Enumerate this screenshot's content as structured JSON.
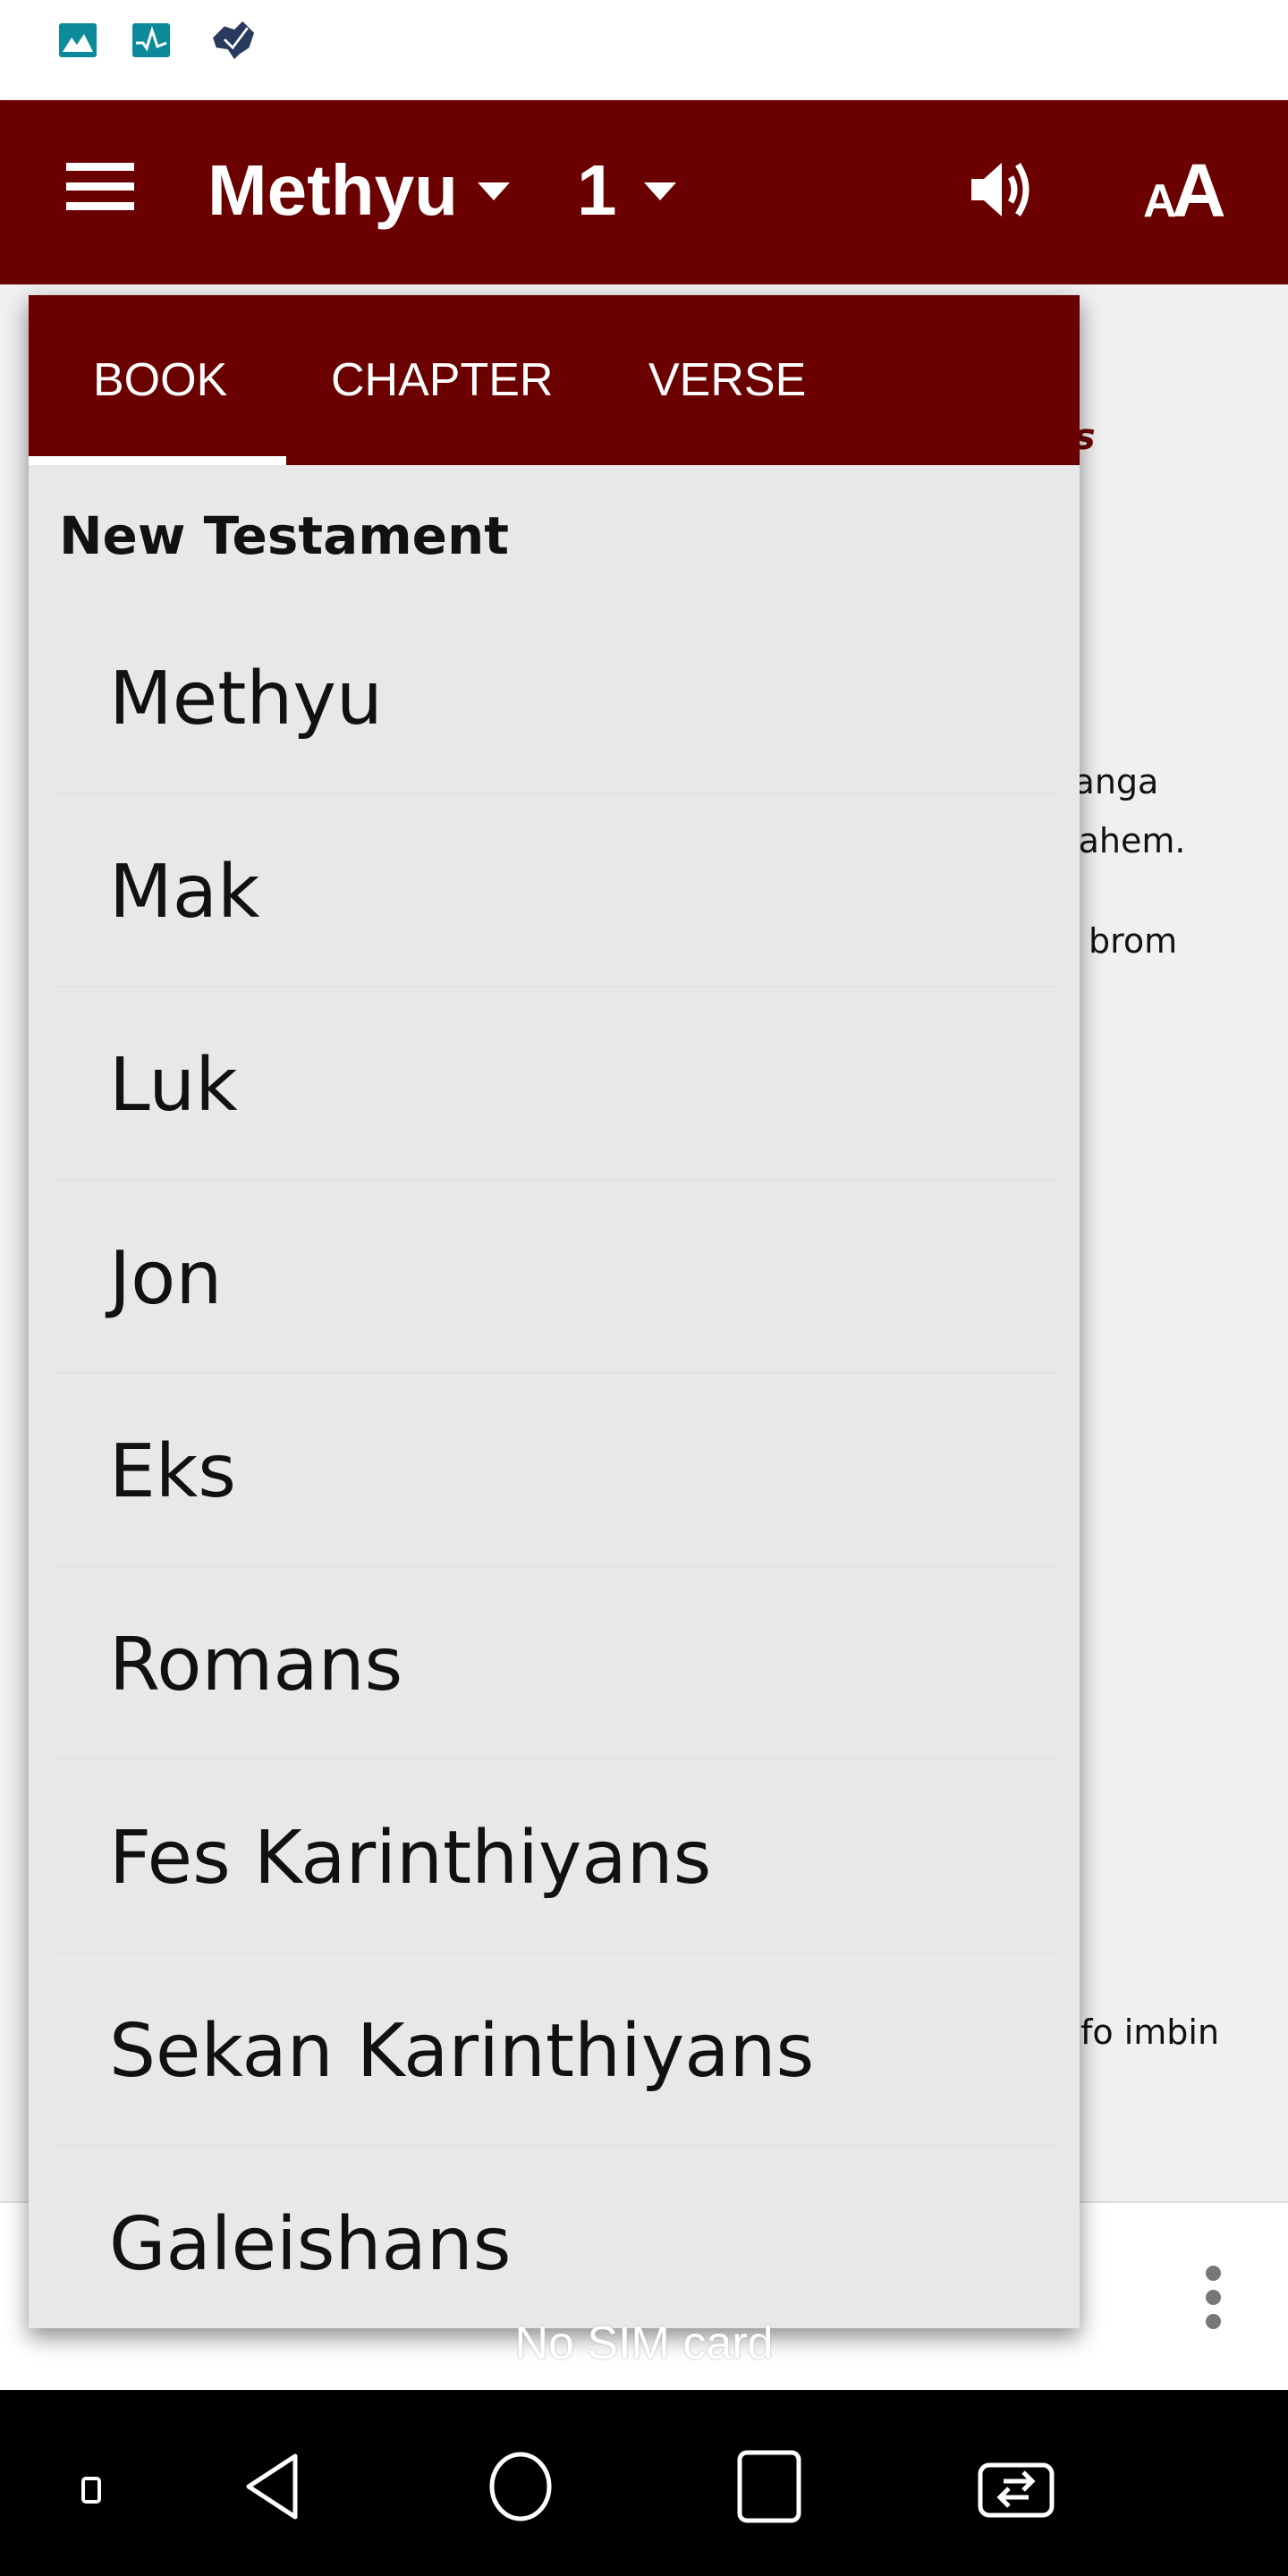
{
  "status_bar": {
    "icons": [
      "gallery-icon",
      "activity-icon",
      "australia-check-icon"
    ]
  },
  "app_bar": {
    "book": "Methyu",
    "chapter": "1",
    "icons": [
      "menu-icon",
      "speaker-icon",
      "text-size-icon"
    ]
  },
  "background_text": {
    "heading_fragment": "sas",
    "lines": [
      "langa",
      "rahem.",
      "t brom",
      "fo imbin"
    ]
  },
  "selector": {
    "tabs": [
      {
        "label": "BOOK",
        "active": true
      },
      {
        "label": "CHAPTER"
      },
      {
        "label": "VERSE"
      }
    ],
    "section": "New Testament",
    "books": [
      "Methyu",
      "Mak",
      "Luk",
      "Jon",
      "Eks",
      "Romans",
      "Fes Karinthiyans",
      "Sekan Karinthiyans",
      "Galeishans"
    ]
  },
  "toast": "No SIM card",
  "colors": {
    "primary": "#6b0000",
    "list_bg": "#e8e8e8",
    "page_bg": "#f0f0f0"
  }
}
